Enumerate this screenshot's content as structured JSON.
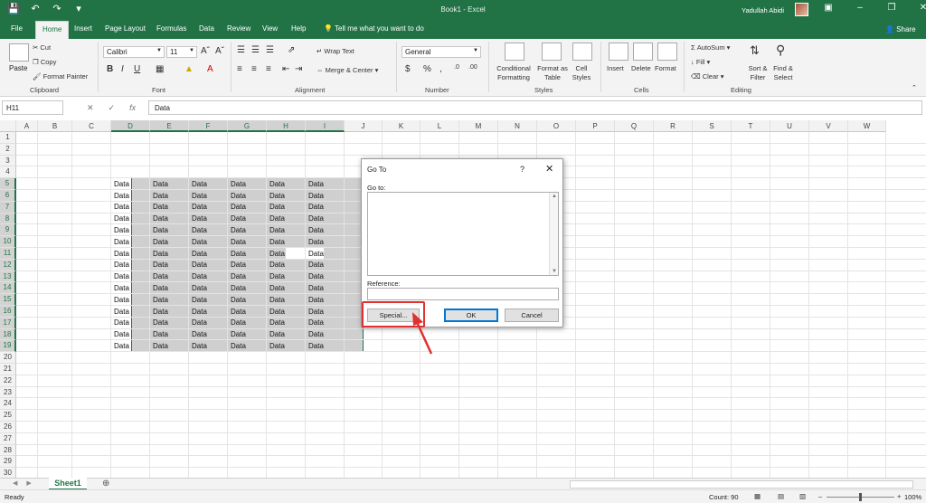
{
  "window": {
    "title": "Book1 - Excel",
    "user": "Yadullah Abidi",
    "share": "Share",
    "tell_me": "Tell me what you want to do"
  },
  "tabs": [
    "File",
    "Home",
    "Insert",
    "Page Layout",
    "Formulas",
    "Data",
    "Review",
    "View",
    "Help"
  ],
  "ribbon": {
    "clipboard": {
      "paste": "Paste",
      "cut": "Cut",
      "copy": "Copy",
      "format_painter": "Format Painter",
      "label": "Clipboard"
    },
    "font": {
      "name": "Calibri",
      "size": "11",
      "label": "Font"
    },
    "alignment": {
      "wrap": "Wrap Text",
      "merge": "Merge & Center",
      "label": "Alignment"
    },
    "number": {
      "format": "General",
      "label": "Number"
    },
    "styles": {
      "conditional": "Conditional Formatting",
      "format_table": "Format as Table",
      "cell_styles": "Cell Styles",
      "label": "Styles"
    },
    "cells": {
      "insert": "Insert",
      "delete": "Delete",
      "format": "Format",
      "label": "Cells"
    },
    "editing": {
      "autosum": "AutoSum",
      "fill": "Fill",
      "clear": "Clear",
      "sort": "Sort & Filter",
      "find": "Find & Select",
      "label": "Editing"
    }
  },
  "formula_bar": {
    "name_box": "H11",
    "content": "Data"
  },
  "columns": [
    "A",
    "B",
    "C",
    "D",
    "E",
    "F",
    "G",
    "H",
    "I",
    "J",
    "K",
    "L",
    "M",
    "N",
    "O",
    "P",
    "Q",
    "R",
    "S",
    "T",
    "U",
    "V",
    "W"
  ],
  "rows": [
    "1",
    "2",
    "3",
    "4",
    "5",
    "6",
    "7",
    "8",
    "9",
    "10",
    "11",
    "12",
    "13",
    "14",
    "15",
    "16",
    "17",
    "18",
    "19",
    "20",
    "21",
    "22",
    "23",
    "24",
    "25",
    "26",
    "27",
    "28",
    "29",
    "30"
  ],
  "cell_value": "Data",
  "dialog": {
    "title": "Go To",
    "help": "?",
    "goto_label": "Go to:",
    "reference_label": "Reference:",
    "special_button": "Special...",
    "ok_button": "OK",
    "cancel_button": "Cancel"
  },
  "sheet_tabs": [
    "Sheet1"
  ],
  "status": {
    "ready": "Ready",
    "count": "Count: 90",
    "zoom": "100%"
  },
  "colors": {
    "brand": "#217346",
    "highlight": "#e0302f",
    "selection": "#cfcfcf"
  }
}
